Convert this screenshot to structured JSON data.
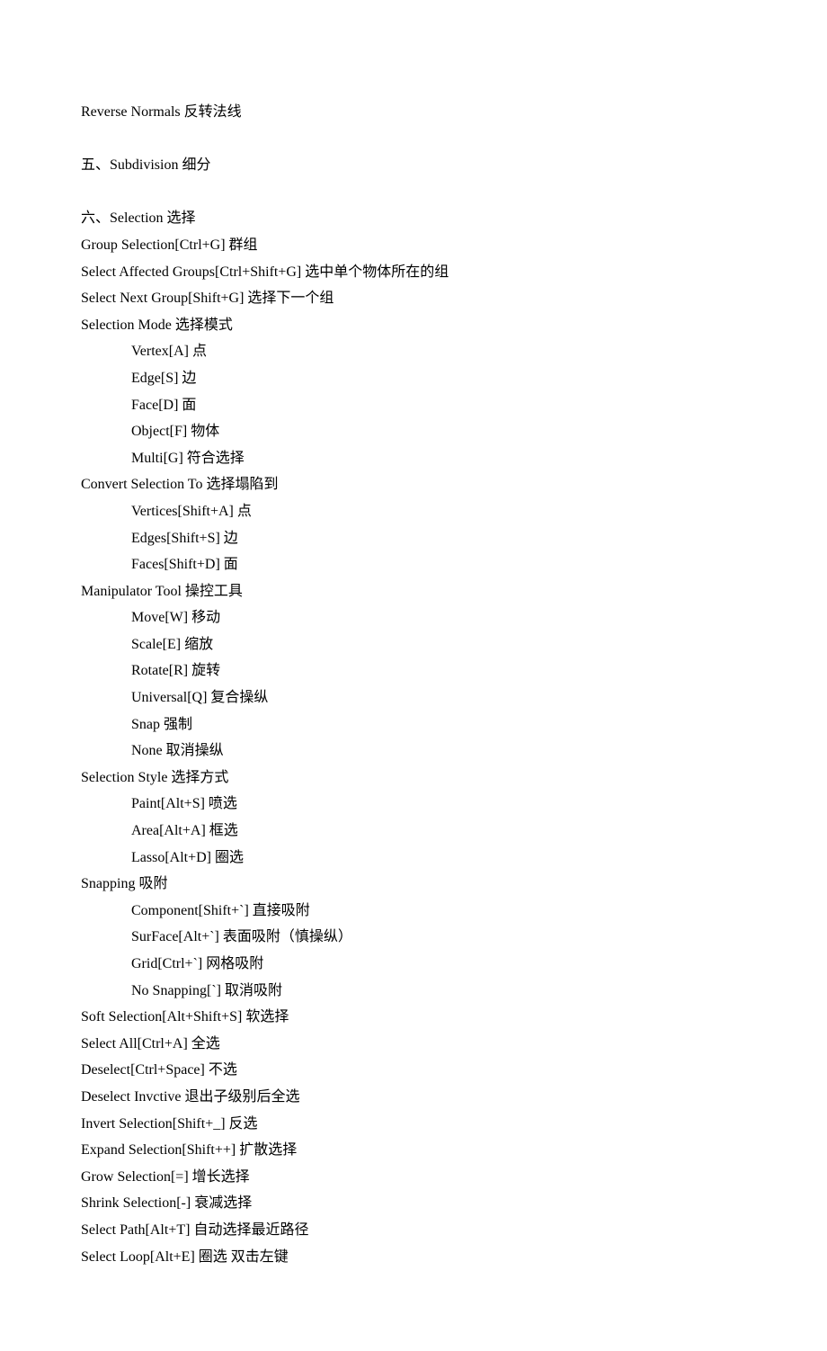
{
  "lines": [
    {
      "text": "Reverse Normals 反转法线",
      "indent": 0
    },
    {
      "blank": true
    },
    {
      "text": "五、Subdivision 细分",
      "indent": 0
    },
    {
      "blank": true
    },
    {
      "text": "六、Selection 选择",
      "indent": 0
    },
    {
      "text": "Group Selection[Ctrl+G] 群组",
      "indent": 0
    },
    {
      "text": "Select Affected Groups[Ctrl+Shift+G] 选中单个物体所在的组",
      "indent": 0
    },
    {
      "text": "Select Next Group[Shift+G] 选择下一个组",
      "indent": 0
    },
    {
      "text": "Selection Mode 选择模式",
      "indent": 0
    },
    {
      "text": "Vertex[A] 点",
      "indent": 1
    },
    {
      "text": "Edge[S] 边",
      "indent": 1
    },
    {
      "text": "Face[D] 面",
      "indent": 1
    },
    {
      "text": "Object[F] 物体",
      "indent": 1
    },
    {
      "text": "Multi[G] 符合选择",
      "indent": 1
    },
    {
      "text": "Convert Selection To 选择塌陷到",
      "indent": 0
    },
    {
      "text": "Vertices[Shift+A] 点",
      "indent": 1
    },
    {
      "text": "Edges[Shift+S] 边",
      "indent": 1
    },
    {
      "text": "Faces[Shift+D] 面",
      "indent": 1
    },
    {
      "text": "Manipulator Tool 操控工具",
      "indent": 0
    },
    {
      "text": "Move[W] 移动",
      "indent": 1
    },
    {
      "text": "Scale[E] 缩放",
      "indent": 1
    },
    {
      "text": "Rotate[R] 旋转",
      "indent": 1
    },
    {
      "text": "Universal[Q] 复合操纵",
      "indent": 1
    },
    {
      "text": "Snap 强制",
      "indent": 1
    },
    {
      "text": "None 取消操纵",
      "indent": 1
    },
    {
      "text": "Selection Style 选择方式",
      "indent": 0
    },
    {
      "text": "Paint[Alt+S] 喷选",
      "indent": 1
    },
    {
      "text": "Area[Alt+A] 框选",
      "indent": 1
    },
    {
      "text": "Lasso[Alt+D] 圈选",
      "indent": 1
    },
    {
      "text": "Snapping 吸附",
      "indent": 0
    },
    {
      "text": "Component[Shift+`] 直接吸附",
      "indent": 1
    },
    {
      "text": "SurFace[Alt+`] 表面吸附（慎操纵）",
      "indent": 1
    },
    {
      "text": "Grid[Ctrl+`] 网格吸附",
      "indent": 1
    },
    {
      "text": "No Snapping[`] 取消吸附",
      "indent": 1
    },
    {
      "text": "Soft Selection[Alt+Shift+S] 软选择",
      "indent": 0
    },
    {
      "text": "Select All[Ctrl+A] 全选",
      "indent": 0
    },
    {
      "text": "Deselect[Ctrl+Space] 不选",
      "indent": 0
    },
    {
      "text": "Deselect Invctive 退出子级别后全选",
      "indent": 0
    },
    {
      "text": "Invert Selection[Shift+_] 反选",
      "indent": 0
    },
    {
      "text": "Expand Selection[Shift++] 扩散选择",
      "indent": 0
    },
    {
      "text": "Grow Selection[=] 增长选择",
      "indent": 0
    },
    {
      "text": "Shrink Selection[-] 衰减选择",
      "indent": 0
    },
    {
      "text": "Select Path[Alt+T] 自动选择最近路径",
      "indent": 0
    },
    {
      "text": "Select Loop[Alt+E] 圈选 双击左键",
      "indent": 0
    }
  ]
}
